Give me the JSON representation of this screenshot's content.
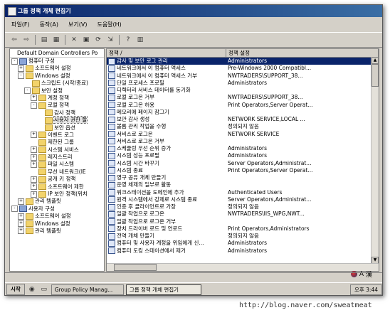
{
  "window": {
    "title": "그룹 정책 개체 편집기"
  },
  "menu": [
    "파일(F)",
    "동작(A)",
    "보기(V)",
    "도움말(H)"
  ],
  "toolbar_icons": [
    "back-icon",
    "forward-icon",
    "up-icon",
    "show-tree-icon",
    "delete-icon",
    "properties-icon",
    "refresh-icon",
    "export-icon",
    "help-icon",
    "view-icon"
  ],
  "tree": {
    "header": "Default Domain Controllers Po",
    "nodes": [
      {
        "label": "컴퓨터 구성",
        "indent": 0,
        "exp": "-",
        "icon": "computer"
      },
      {
        "label": "소프트웨어 설정",
        "indent": 1,
        "exp": "+",
        "icon": "folder"
      },
      {
        "label": "Windows 설정",
        "indent": 1,
        "exp": "-",
        "icon": "folder"
      },
      {
        "label": "스크립트 (시작/종료)",
        "indent": 2,
        "exp": "",
        "icon": "folder"
      },
      {
        "label": "보안 설정",
        "indent": 2,
        "exp": "-",
        "icon": "folder"
      },
      {
        "label": "계정 정책",
        "indent": 3,
        "exp": "+",
        "icon": "folder"
      },
      {
        "label": "로컬 정책",
        "indent": 3,
        "exp": "-",
        "icon": "folder"
      },
      {
        "label": "감사 정책",
        "indent": 4,
        "exp": "",
        "icon": "folder"
      },
      {
        "label": "사용자 권한 할",
        "indent": 4,
        "exp": "",
        "icon": "folder",
        "selected": true
      },
      {
        "label": "보안 옵션",
        "indent": 4,
        "exp": "",
        "icon": "folder"
      },
      {
        "label": "이벤트 로그",
        "indent": 3,
        "exp": "+",
        "icon": "folder"
      },
      {
        "label": "제한된 그룹",
        "indent": 3,
        "exp": "",
        "icon": "folder"
      },
      {
        "label": "시스템 서비스",
        "indent": 3,
        "exp": "+",
        "icon": "folder"
      },
      {
        "label": "레지스트리",
        "indent": 3,
        "exp": "+",
        "icon": "folder"
      },
      {
        "label": "파일 시스템",
        "indent": 3,
        "exp": "+",
        "icon": "folder"
      },
      {
        "label": "무선 네트워크(IE",
        "indent": 3,
        "exp": "",
        "icon": "folder"
      },
      {
        "label": "공개 키 정책",
        "indent": 3,
        "exp": "+",
        "icon": "folder"
      },
      {
        "label": "소프트웨어 제한",
        "indent": 3,
        "exp": "+",
        "icon": "folder"
      },
      {
        "label": "IP 보안 정책(위치",
        "indent": 3,
        "exp": "+",
        "icon": "folder"
      },
      {
        "label": "관리 템플릿",
        "indent": 1,
        "exp": "+",
        "icon": "folder"
      },
      {
        "label": "사용자 구성",
        "indent": 0,
        "exp": "-",
        "icon": "computer"
      },
      {
        "label": "소프트웨어 설정",
        "indent": 1,
        "exp": "+",
        "icon": "folder"
      },
      {
        "label": "Windows 설정",
        "indent": 1,
        "exp": "+",
        "icon": "folder"
      },
      {
        "label": "관리 템플릿",
        "indent": 1,
        "exp": "+",
        "icon": "folder"
      }
    ]
  },
  "list": {
    "columns": [
      "정책 /",
      "정책 설정"
    ],
    "rows": [
      {
        "policy": "감사 및 보안 로그 관리",
        "setting": "Administrators",
        "selected": true
      },
      {
        "policy": "네트워크에서 이 컴퓨터 액세스",
        "setting": "Pre-Windows 2000 Compatibl..."
      },
      {
        "policy": "네트워크에서 이 컴퓨터 액세스 거부",
        "setting": "NWTRADERS\\SUPPORT_38..."
      },
      {
        "policy": "단일 프로세스 프로필",
        "setting": "Administrators"
      },
      {
        "policy": "디렉터리 서비스 데이터를 동기화",
        "setting": ""
      },
      {
        "policy": "로컬 로그온 거부",
        "setting": "NWTRADERS\\SUPPORT_38..."
      },
      {
        "policy": "로컬 로그온 허용",
        "setting": "Print Operators,Server Operat..."
      },
      {
        "policy": "메모리에 페이지 잠그기",
        "setting": ""
      },
      {
        "policy": "보안 감사 생성",
        "setting": "NETWORK SERVICE,LOCAL ..."
      },
      {
        "policy": "볼륨 관리 작업을 수행",
        "setting": "정의되지 않음"
      },
      {
        "policy": "서비스로 로그온",
        "setting": "NETWORK SERVICE"
      },
      {
        "policy": "서비스로 로그온 거부",
        "setting": ""
      },
      {
        "policy": "스케줄링 우선 순위 증가",
        "setting": "Administrators"
      },
      {
        "policy": "시스템 성능 프로필",
        "setting": "Administrators"
      },
      {
        "policy": "시스템 시간 바꾸기",
        "setting": "Server Operators,Administrat..."
      },
      {
        "policy": "시스템 종료",
        "setting": "Print Operators,Server Operat..."
      },
      {
        "policy": "영구 공유 개체 만들기",
        "setting": ""
      },
      {
        "policy": "운영 체제의 일부로 활동",
        "setting": ""
      },
      {
        "policy": "워크스테이션을 도메인에 추가",
        "setting": "Authenticated Users"
      },
      {
        "policy": "원격 시스템에서 강제로 시스템 종료",
        "setting": "Server Operators,Administrat..."
      },
      {
        "policy": "인증 후 클라이언트로 가장",
        "setting": "정의되지 않음"
      },
      {
        "policy": "일괄 작업으로 로그온",
        "setting": "NWTRADERS\\IIS_WPG,NWT..."
      },
      {
        "policy": "일괄 작업으로 로그온 거부",
        "setting": ""
      },
      {
        "policy": "장치 드라이버 로드 및 언로드",
        "setting": "Print Operators,Administrators"
      },
      {
        "policy": "전역 개체 만들기",
        "setting": "정의되지 않음"
      },
      {
        "policy": "컴퓨터 및 사용자 계정을 위임에게 신...",
        "setting": "Administrators"
      },
      {
        "policy": "컴퓨터 도킹 스테이션에서 제거",
        "setting": "Administrators"
      }
    ]
  },
  "taskbar": {
    "start": "시작",
    "tasks": [
      {
        "label": "Group Policy Manag...",
        "active": false
      },
      {
        "label": "그룹 정책 개체 편집기",
        "active": true
      }
    ],
    "clock": "오후 3:44"
  },
  "ime": {
    "han": "漢",
    "a": "A"
  },
  "credit": "http://blog.naver.com/sweatmeat"
}
